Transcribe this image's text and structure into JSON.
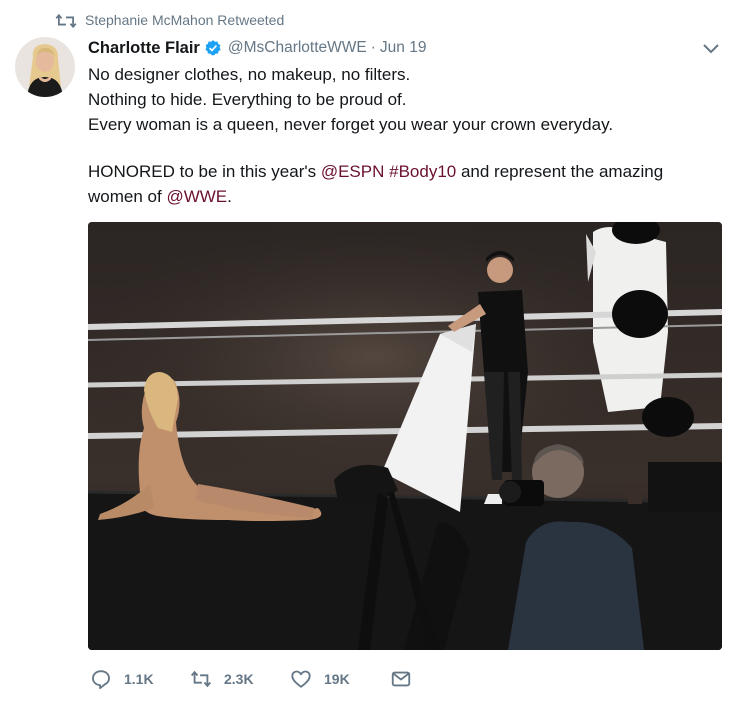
{
  "retweet_context": {
    "label": "Stephanie McMahon Retweeted",
    "icon": "retweet-icon"
  },
  "author": {
    "display_name": "Charlotte Flair",
    "handle": "@MsCharlotteWWE",
    "separator": "·",
    "date": "Jun 19",
    "verified": true,
    "avatar_icon": "avatar"
  },
  "tweet": {
    "lines": [
      "No designer clothes, no makeup, no filters.",
      "Nothing to hide. Everything to be proud of.",
      "Every woman is a queen, never forget you wear your crown everyday."
    ],
    "line4": {
      "pre": "HONORED to be in this year's ",
      "mention1": "@ESPN",
      "space": " ",
      "hashtag": "#Body10",
      "post": " and represent the amazing"
    },
    "line5": {
      "pre": "women of ",
      "mention2": "@WWE",
      "post": "."
    }
  },
  "actions": {
    "reply_count": "1.1K",
    "retweet_count": "2.3K",
    "like_count": "19K"
  },
  "colors": {
    "link": "#6b1130",
    "muted": "#657786",
    "text": "#14171a",
    "verified": "#1da1f2"
  }
}
